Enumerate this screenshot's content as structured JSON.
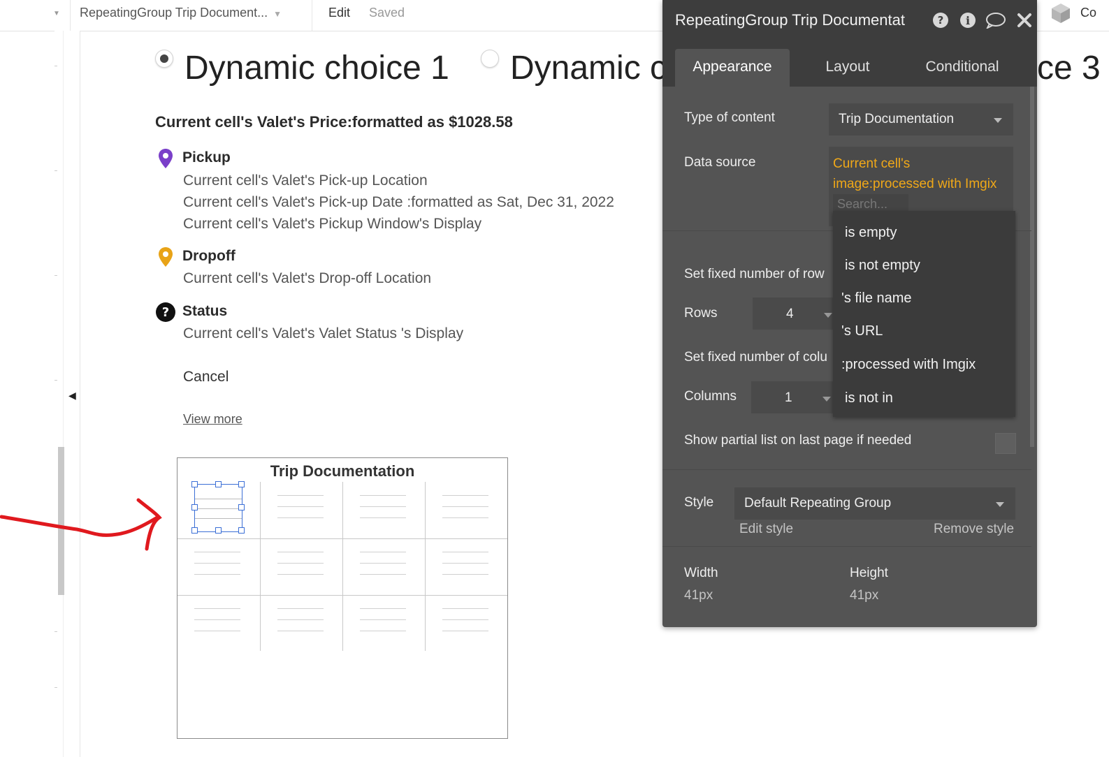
{
  "topbar": {
    "page_select": "RepeatingGroup Trip Document...",
    "edit_label": "Edit",
    "saved_label": "Saved",
    "right_cut_label": "Co"
  },
  "canvas": {
    "choices": [
      {
        "label": "Dynamic choice 1",
        "checked": true
      },
      {
        "label": "Dynamic c",
        "checked": false
      },
      {
        "label": "ce 3",
        "checked": false
      }
    ],
    "price": "Current cell's Valet's Price:formatted as $1028.58",
    "pickup": {
      "title": "Pickup",
      "lines": [
        "Current cell's Valet's Pick-up Location",
        "Current cell's Valet's Pick-up Date :formatted as Sat, Dec 31, 2022",
        "Current cell's Valet's Pickup Window's Display"
      ]
    },
    "dropoff": {
      "title": "Dropoff",
      "lines": [
        "Current cell's Valet's Drop-off Location"
      ]
    },
    "status": {
      "title": "Status",
      "lines": [
        "Current cell's Valet's Valet Status 's Display"
      ]
    },
    "cancel_label": "Cancel",
    "view_more_label": "View more",
    "repeating_group_title": "Trip Documentation"
  },
  "panel": {
    "title": "RepeatingGroup Trip Documentat",
    "tabs": [
      "Appearance",
      "Layout",
      "Conditional"
    ],
    "active_tab": "Appearance",
    "type_of_content_label": "Type of content",
    "type_of_content_value": "Trip Documentation",
    "data_source_label": "Data source",
    "data_source_value": "Current cell's image:processed with Imgix",
    "search_placeholder": "Search...",
    "fixed_rows_label": "Set fixed number of row",
    "rows_label": "Rows",
    "rows_value": "4",
    "fixed_cols_label": "Set fixed number of colu",
    "columns_label": "Columns",
    "columns_value": "1",
    "partial_list_label": "Show partial list on last page if needed",
    "style_label": "Style",
    "style_value": "Default Repeating Group",
    "edit_style_label": "Edit style",
    "remove_style_label": "Remove style",
    "width_label": "Width",
    "width_value": "41px",
    "height_label": "Height",
    "height_value": "41px"
  },
  "dropdown_menu": {
    "items": [
      "is empty",
      "is not empty",
      "'s file name",
      "'s URL",
      ":processed with Imgix",
      "is not in"
    ]
  },
  "colors": {
    "accent_orange": "#f0a818",
    "pickup_pin": "#7a3fc9",
    "dropoff_pin": "#e8a317",
    "panel_bg": "#545454",
    "selection_blue": "#3b6fd6",
    "annotation_red": "#e0191e"
  }
}
